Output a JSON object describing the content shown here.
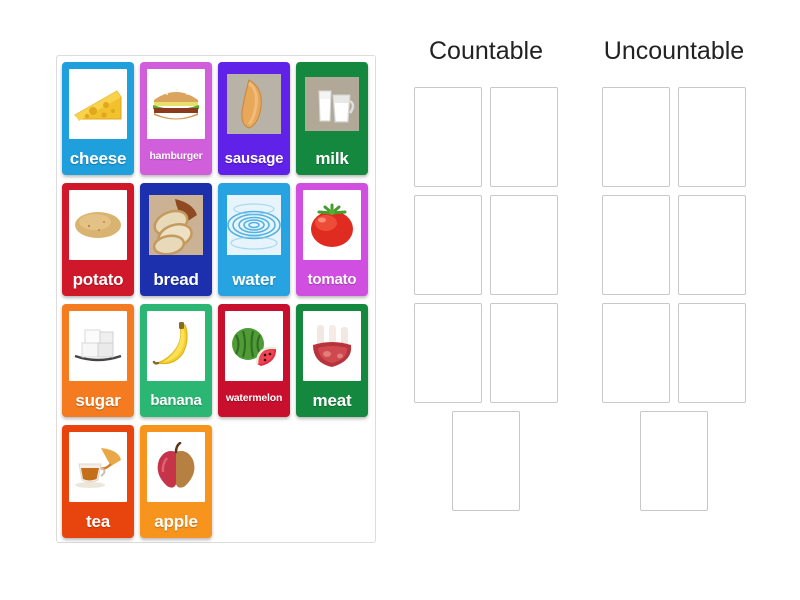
{
  "activity": {
    "type": "group-sort-drag-drop"
  },
  "tray": {
    "name": "word-card-tray",
    "cards": [
      {
        "label": "cheese",
        "color": "#1f9fdc",
        "icon": "cheese-wedge",
        "label_size": "lg"
      },
      {
        "label": "hamburger",
        "color": "#d15fdc",
        "icon": "hamburger",
        "label_size": "sm"
      },
      {
        "label": "sausage",
        "color": "#6021e8",
        "icon": "sausage",
        "label_size": "md"
      },
      {
        "label": "milk",
        "color": "#15883f",
        "icon": "milk-jug",
        "label_size": "lg"
      },
      {
        "label": "potato",
        "color": "#d0182b",
        "icon": "potato",
        "label_size": "lg"
      },
      {
        "label": "bread",
        "color": "#1c30ad",
        "icon": "bread-loaf",
        "label_size": "lg"
      },
      {
        "label": "water",
        "color": "#26a3e0",
        "icon": "water-ripple",
        "label_size": "lg"
      },
      {
        "label": "tomato",
        "color": "#d14fe0",
        "icon": "tomato",
        "label_size": "md"
      },
      {
        "label": "sugar",
        "color": "#f47b20",
        "icon": "sugar-cubes",
        "label_size": "lg"
      },
      {
        "label": "banana",
        "color": "#2bb673",
        "icon": "banana",
        "label_size": "md"
      },
      {
        "label": "watermelon",
        "color": "#c8102e",
        "icon": "watermelon",
        "label_size": "sm"
      },
      {
        "label": "meat",
        "color": "#15883f",
        "icon": "meat-ribs",
        "label_size": "lg"
      },
      {
        "label": "tea",
        "color": "#e8440e",
        "icon": "tea-cup",
        "label_size": "lg"
      },
      {
        "label": "apple",
        "color": "#f7941e",
        "icon": "apple",
        "label_size": "lg"
      }
    ]
  },
  "buckets": [
    {
      "title": "Countable",
      "slot_count": 7,
      "slots": [
        "",
        "",
        "",
        "",
        "",
        "",
        ""
      ]
    },
    {
      "title": "Uncountable",
      "slot_count": 7,
      "slots": [
        "",
        "",
        "",
        "",
        "",
        "",
        ""
      ]
    }
  ],
  "colors": {
    "page_background": "#ffffff",
    "tray_border": "#dcdcdc",
    "slot_border": "#c8c8c8",
    "title_text": "#222222",
    "card_label_text": "#ffffff"
  }
}
